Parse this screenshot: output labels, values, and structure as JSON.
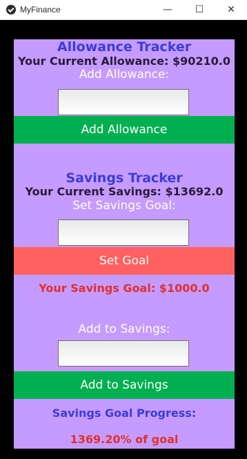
{
  "window": {
    "title": "MyFinance",
    "minimize_glyph": "—",
    "maximize_glyph": "☐",
    "close_glyph": "✕"
  },
  "allowance": {
    "heading": "Allowance Tracker",
    "current": "Your Current Allowance: $90210.0",
    "input_label": "Add Allowance:",
    "input_value": "",
    "button_label": "Add Allowance"
  },
  "savings": {
    "heading": "Savings Tracker",
    "current": "Your Current Savings: $13692.0",
    "goal_input_label": "Set Savings Goal:",
    "goal_input_value": "",
    "goal_button_label": "Set Goal",
    "goal_text": "Your Savings Goal: $1000.0",
    "add_input_label": "Add to Savings:",
    "add_input_value": "",
    "add_button_label": "Add to Savings",
    "progress_label": "Savings Goal Progress:",
    "progress_value": "1369.20% of goal"
  },
  "colors": {
    "panel_bg": "#c59bff",
    "heading": "#3c3cd6",
    "green_button": "#00b050",
    "red_button": "#ff6060",
    "goal_text": "#e0302a"
  }
}
